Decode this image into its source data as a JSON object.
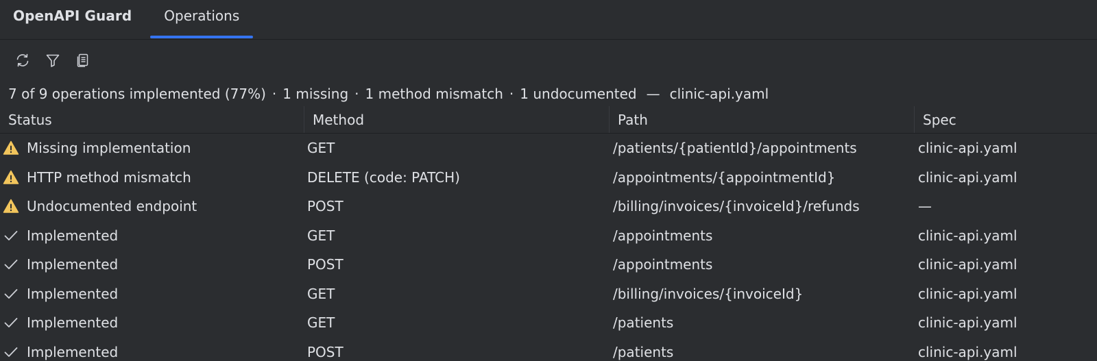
{
  "header": {
    "title": "OpenAPI Guard",
    "tabs": [
      {
        "label": "Operations",
        "active": true
      }
    ]
  },
  "toolbar": {
    "buttons": [
      {
        "icon": "refresh-icon"
      },
      {
        "icon": "filter-icon"
      },
      {
        "icon": "document-copy-icon"
      }
    ]
  },
  "summary": {
    "implemented": "7 of 9 operations implemented (77%)",
    "separator": "·",
    "missing": "1 missing",
    "mismatch": "1 method mismatch",
    "undocumented": "1 undocumented",
    "dash": "—",
    "spec_file": "clinic-api.yaml"
  },
  "table": {
    "columns": [
      "Status",
      "Method",
      "Path",
      "Spec"
    ],
    "rows": [
      {
        "status_icon": "warning",
        "status": "Missing implementation",
        "method": "GET",
        "path": "/patients/{patientId}/appointments",
        "spec": "clinic-api.yaml"
      },
      {
        "status_icon": "warning",
        "status": "HTTP method mismatch",
        "method": "DELETE (code: PATCH)",
        "path": "/appointments/{appointmentId}",
        "spec": "clinic-api.yaml"
      },
      {
        "status_icon": "warning",
        "status": "Undocumented endpoint",
        "method": "POST",
        "path": "/billing/invoices/{invoiceId}/refunds",
        "spec": "—"
      },
      {
        "status_icon": "check",
        "status": "Implemented",
        "method": "GET",
        "path": "/appointments",
        "spec": "clinic-api.yaml"
      },
      {
        "status_icon": "check",
        "status": "Implemented",
        "method": "POST",
        "path": "/appointments",
        "spec": "clinic-api.yaml"
      },
      {
        "status_icon": "check",
        "status": "Implemented",
        "method": "GET",
        "path": "/billing/invoices/{invoiceId}",
        "spec": "clinic-api.yaml"
      },
      {
        "status_icon": "check",
        "status": "Implemented",
        "method": "GET",
        "path": "/patients",
        "spec": "clinic-api.yaml"
      },
      {
        "status_icon": "check",
        "status": "Implemented",
        "method": "POST",
        "path": "/patients",
        "spec": "clinic-api.yaml"
      }
    ]
  },
  "colors": {
    "background": "#2b2d30",
    "text": "#dfe1e5",
    "accent": "#3574f0",
    "warning": "#f2c55c"
  }
}
